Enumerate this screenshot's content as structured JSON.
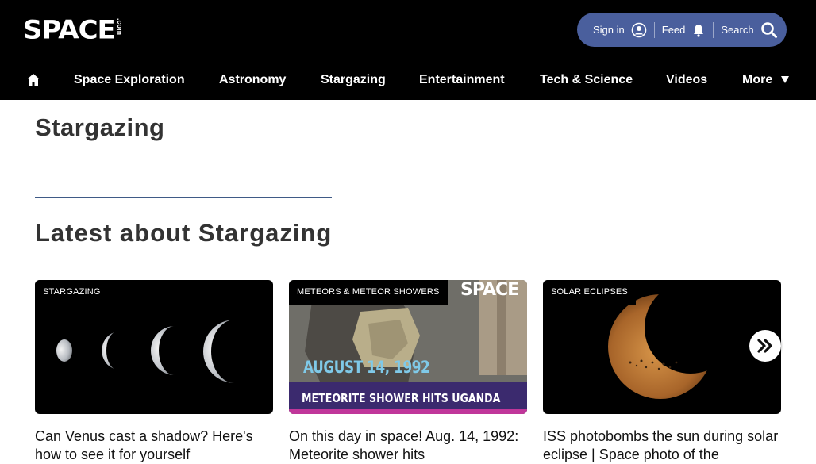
{
  "header": {
    "logo_text": "SPACE",
    "logo_suffix": ".com",
    "signin_label": "Sign in",
    "feed_label": "Feed",
    "search_label": "Search"
  },
  "nav": {
    "items": [
      {
        "label": "Space Exploration"
      },
      {
        "label": "Astronomy"
      },
      {
        "label": "Stargazing"
      },
      {
        "label": "Entertainment"
      },
      {
        "label": "Tech & Science"
      },
      {
        "label": "Videos"
      },
      {
        "label": "More"
      }
    ]
  },
  "page": {
    "title": "Stargazing",
    "section_title": "Latest about Stargazing"
  },
  "cards": [
    {
      "tag": "STARGAZING",
      "title": "Can Venus cast a shadow? Here's how to see it for yourself"
    },
    {
      "tag": "METEORS & METEOR SHOWERS",
      "title": "On this day in space! Aug. 14, 1992: Meteorite shower hits",
      "overlay_date": "AUGUST 14, 1992",
      "overlay_caption": "METEORITE SHOWER HITS UGANDA",
      "overlay_logo": "SPACE"
    },
    {
      "tag": "SOLAR ECLIPSES",
      "title": "ISS photobombs the sun during solar eclipse | Space photo of the"
    }
  ],
  "colors": {
    "header_bg": "#000000",
    "pill_bg": "#4a5f9d",
    "accent_rule": "#3f5a86"
  }
}
